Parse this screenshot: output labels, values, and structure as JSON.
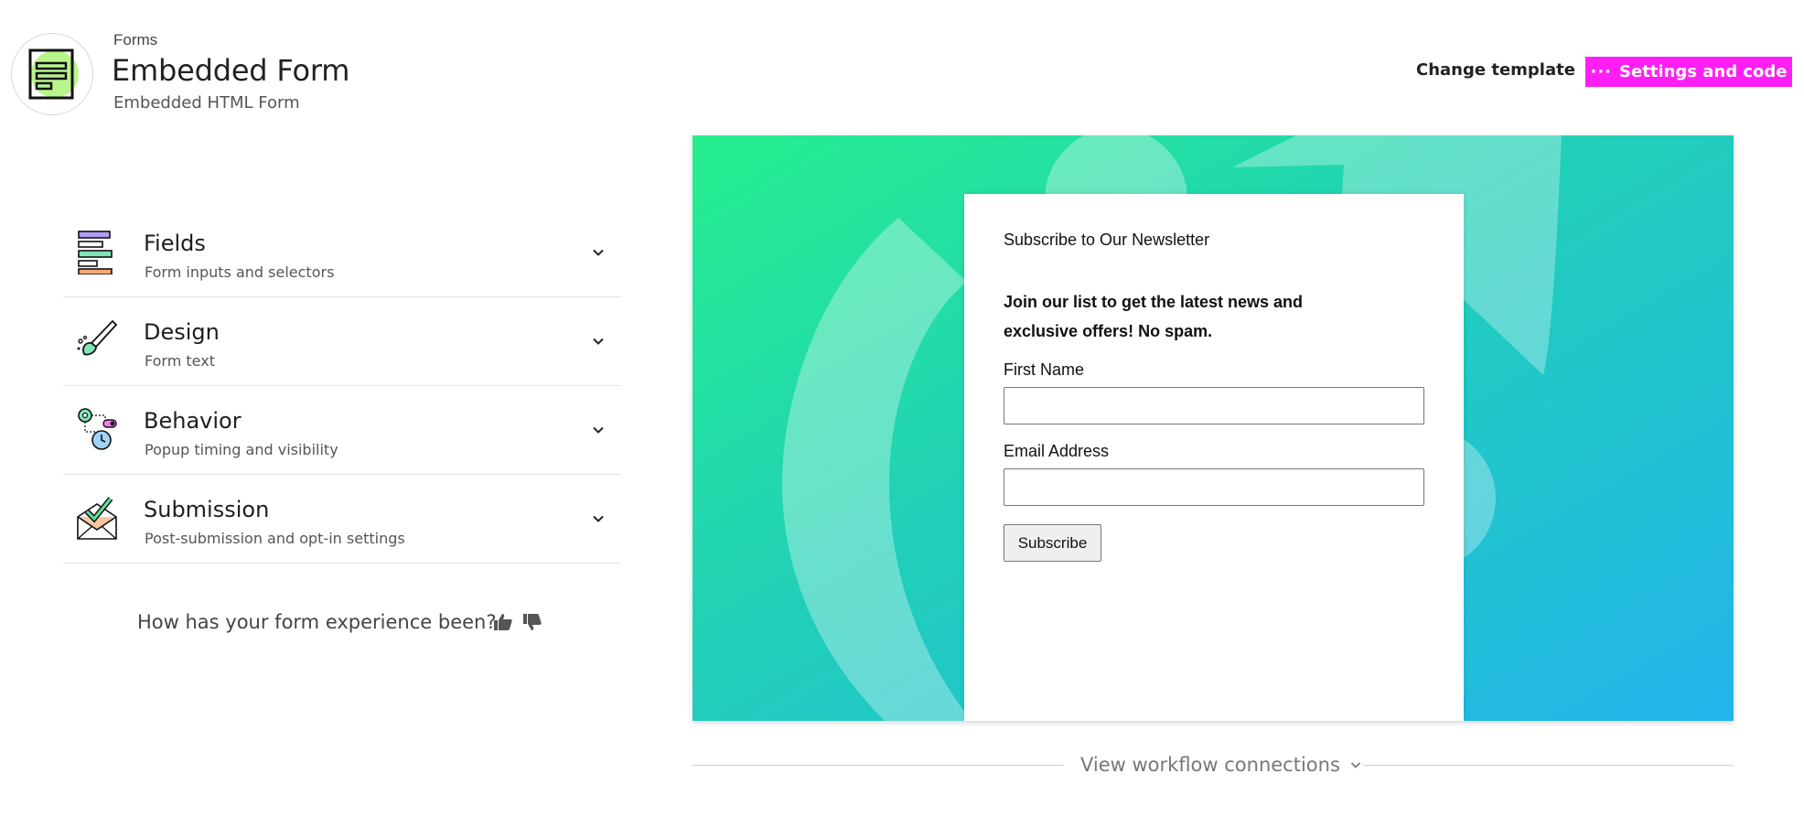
{
  "header": {
    "breadcrumb": "Forms",
    "title": "Embedded Form",
    "subtitle": "Embedded HTML Form",
    "change_template_label": "Change template",
    "settings_label": "Settings and code",
    "settings_icon": "more-dots-icon",
    "app_icon": "form-document-icon"
  },
  "colors": {
    "accent": "#ff1ff5",
    "preview_gradient_start": "#26ef8e",
    "preview_gradient_end": "#22b4ec"
  },
  "sidebar": {
    "sections": [
      {
        "title": "Fields",
        "description": "Form inputs and selectors",
        "icon": "fields-bars-icon"
      },
      {
        "title": "Design",
        "description": "Form text",
        "icon": "paintbrush-icon"
      },
      {
        "title": "Behavior",
        "description": "Popup timing and visibility",
        "icon": "gear-clock-icon"
      },
      {
        "title": "Submission",
        "description": "Post-submission and opt-in settings",
        "icon": "envelope-check-icon"
      }
    ],
    "feedback_question": "How has your form experience been?",
    "feedback_icons": [
      "thumbs-up-icon",
      "thumbs-down-icon"
    ]
  },
  "preview": {
    "form": {
      "heading": "Subscribe to Our Newsletter",
      "intro": "Join our list to get the latest news and exclusive offers! No spam.",
      "fields": [
        {
          "label": "First Name",
          "value": "",
          "placeholder": ""
        },
        {
          "label": "Email Address",
          "value": "",
          "placeholder": ""
        }
      ],
      "submit_label": "Subscribe"
    }
  },
  "workflow": {
    "label": "View workflow connections"
  }
}
